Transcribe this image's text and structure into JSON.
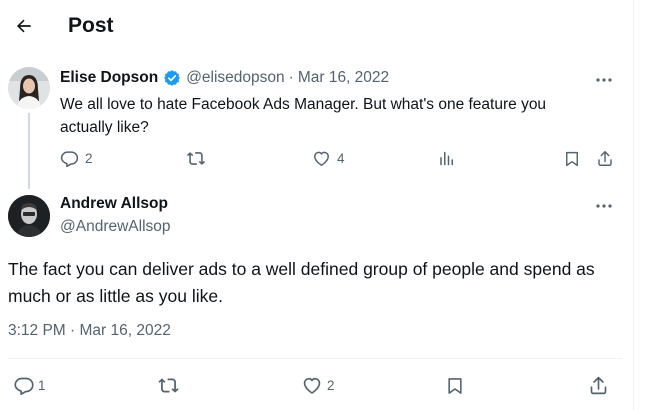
{
  "header": {
    "title": "Post",
    "back_icon": "arrow-left-icon"
  },
  "parent_tweet": {
    "author_name": "Elise Dopson",
    "verified": true,
    "handle": "@elisedopson",
    "separator": "·",
    "date": "Mar 16, 2022",
    "text": "We all love to hate Facebook Ads Manager. But what's one feature you actually like?",
    "actions": {
      "reply_count": "2",
      "retweet_count": "",
      "like_count": "4",
      "views_count": ""
    }
  },
  "reply_tweet": {
    "author_name": "Andrew Allsop",
    "handle": "@AndrewAllsop",
    "text": "The fact you can deliver ads to a well defined group of people and spend as much or as little as you like.",
    "timestamp": "3:12 PM · Mar 16, 2022",
    "actions": {
      "reply_count": "1",
      "retweet_count": "",
      "like_count": "2"
    }
  },
  "colors": {
    "text": "#0f1419",
    "muted": "#536471",
    "verified": "#1d9bf0",
    "border": "#eff3f4"
  }
}
